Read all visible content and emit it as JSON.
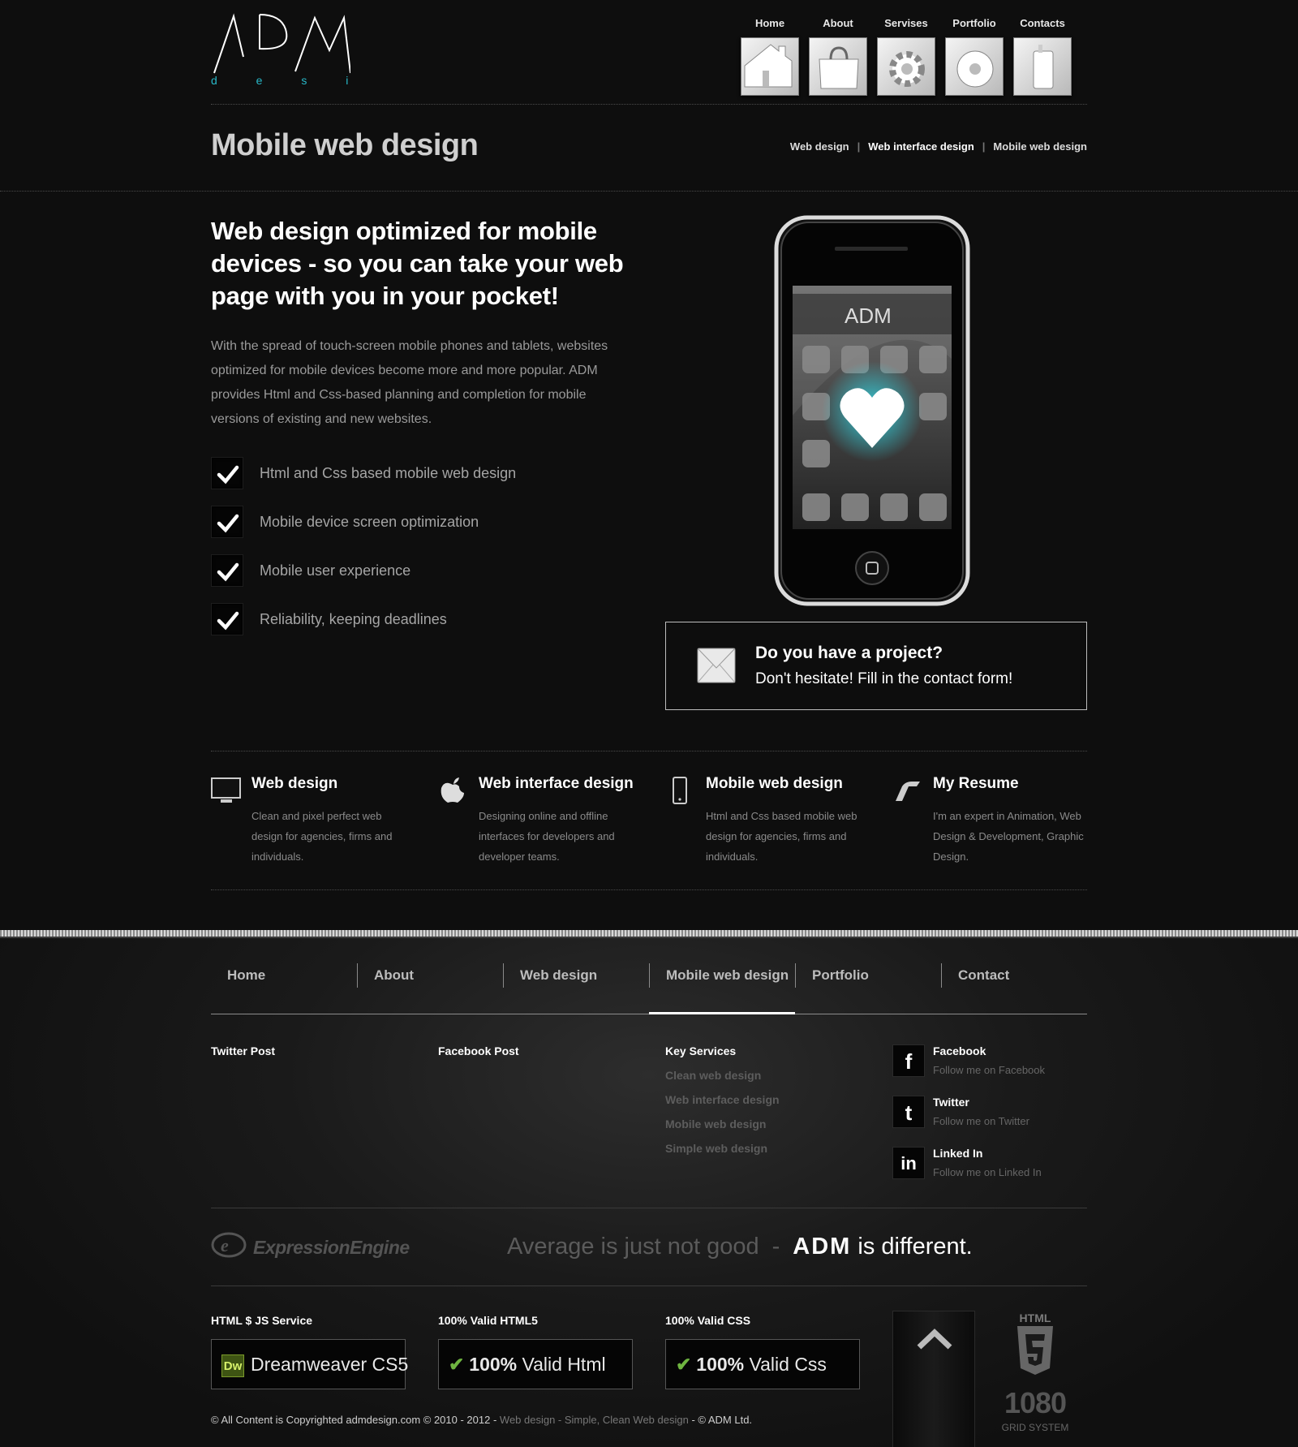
{
  "logo": {
    "main": "ADM",
    "sub": "d e s i g n"
  },
  "topnav": [
    {
      "label": "Home",
      "icon": "home-icon"
    },
    {
      "label": "About",
      "icon": "bag-icon"
    },
    {
      "label": "Servises",
      "icon": "gear-icon"
    },
    {
      "label": "Portfolio",
      "icon": "disc-icon"
    },
    {
      "label": "Contacts",
      "icon": "phone-icon"
    }
  ],
  "page_title": "Mobile web design",
  "breadcrumbs": [
    "Web design",
    "Web interface design",
    "Mobile web design"
  ],
  "hero": {
    "heading": "Web design optimized for mobile devices - so you can take your web page with you in your pocket!",
    "paragraph": "With the spread of touch-screen mobile phones and tablets, websites optimized for mobile devices become more and more popular. ADM provides Html and Css-based planning and completion for mobile versions of existing and new websites.",
    "features": [
      "Html and Css based mobile web design",
      "Mobile device screen optimization",
      "Mobile user experience",
      "Reliability, keeping deadlines"
    ]
  },
  "project_box": {
    "heading": "Do you have a project?",
    "subtext": "Don't hesitate! Fill in the contact form!"
  },
  "services": [
    {
      "title": "Web design",
      "text": "Clean and pixel perfect web design for agencies, firms and individuals.",
      "icon": "monitor-icon"
    },
    {
      "title": "Web interface design",
      "text": "Designing online and offline interfaces for developers and developer teams.",
      "icon": "apple-icon"
    },
    {
      "title": "Mobile web design",
      "text": "Html and Css based mobile web design for agencies, firms and individuals.",
      "icon": "mobile-icon"
    },
    {
      "title": "My Resume",
      "text": "I'm an expert in Animation, Web Design & Development, Graphic Design.",
      "icon": "resume-icon"
    }
  ],
  "footer_nav": [
    "Home",
    "About",
    "Web design",
    "Mobile web design",
    "Portfolio",
    "Contact"
  ],
  "footer_nav_active": "Mobile web design",
  "footer_cols": {
    "twitter": "Twitter Post",
    "facebook": "Facebook Post",
    "key_services": "Key Services"
  },
  "key_services": [
    "Clean web design",
    "Web interface design",
    "Mobile web design",
    "Simple web design"
  ],
  "social": [
    {
      "name": "Facebook",
      "sub": "Follow me on Facebook",
      "glyph": "f",
      "icon": "facebook-icon"
    },
    {
      "name": "Twitter",
      "sub": "Follow me on Twitter",
      "glyph": "t",
      "icon": "twitter-icon"
    },
    {
      "name": "Linked In",
      "sub": "Follow me on Linked In",
      "glyph": "in",
      "icon": "linkedin-icon"
    }
  ],
  "expression_engine": "ExpressionEngine",
  "tagline": {
    "part1": "Average is just not good",
    "dash": "-",
    "brand": "ADM",
    "part2": "is different."
  },
  "badges": [
    {
      "heading": "HTML $ JS Service",
      "text": "Dreamweaver  CS5",
      "logo": "Dw"
    },
    {
      "heading": "100% Valid HTML5",
      "bold": "100%",
      "text": " Valid Html"
    },
    {
      "heading": "100% Valid CSS",
      "bold": "100%",
      "text": " Valid Css"
    }
  ],
  "html5_badge": {
    "top": "HTML",
    "num": "1080",
    "bottom": "GRID SYSTEM"
  },
  "copyright": {
    "a": "© All Content is Copyrighted admdesign.com © 2010 - 2012 - ",
    "b": "Web design - Simple, Clean Web design",
    "c": " - © ADM Ltd."
  },
  "colors": {
    "accent": "#28b8c8",
    "background": "#0e0e0e"
  }
}
